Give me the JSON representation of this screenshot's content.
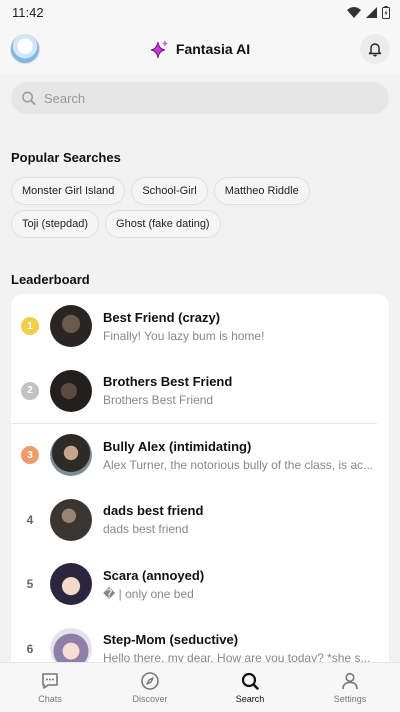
{
  "status": {
    "time": "11:42"
  },
  "header": {
    "app_name": "Fantasia AI"
  },
  "search": {
    "placeholder": "Search"
  },
  "popular": {
    "title": "Popular Searches",
    "chips": [
      "Monster Girl Island",
      "School-Girl",
      "Mattheo Riddle",
      "Toji (stepdad)",
      "Ghost (fake dating)"
    ]
  },
  "leaderboard": {
    "title": "Leaderboard",
    "rows": [
      {
        "rank": "1",
        "name": "Best Friend (crazy)",
        "desc": "Finally! You lazy bum is home!",
        "rank_color": "#f2cf4a"
      },
      {
        "rank": "2",
        "name": "Brothers Best Friend",
        "desc": "Brothers Best Friend",
        "rank_color": "#c2c2c2"
      },
      {
        "rank": "3",
        "name": "Bully Alex (intimidating)",
        "desc": "Alex Turner, the notorious bully of the class, is ac...",
        "rank_color": "#ef9b6b"
      },
      {
        "rank": "4",
        "name": "dads best friend",
        "desc": "dads best friend"
      },
      {
        "rank": "5",
        "name": "Scara (annoyed)",
        "desc": "� | only one bed"
      },
      {
        "rank": "6",
        "name": "Step-Mom (seductive)",
        "desc": "Hello there, my dear. How are you today? *she s..."
      }
    ]
  },
  "nav": {
    "items": [
      {
        "label": "Chats",
        "icon": "chat-icon"
      },
      {
        "label": "Discover",
        "icon": "compass-icon"
      },
      {
        "label": "Search",
        "icon": "search-icon",
        "active": true
      },
      {
        "label": "Settings",
        "icon": "person-icon"
      }
    ]
  }
}
